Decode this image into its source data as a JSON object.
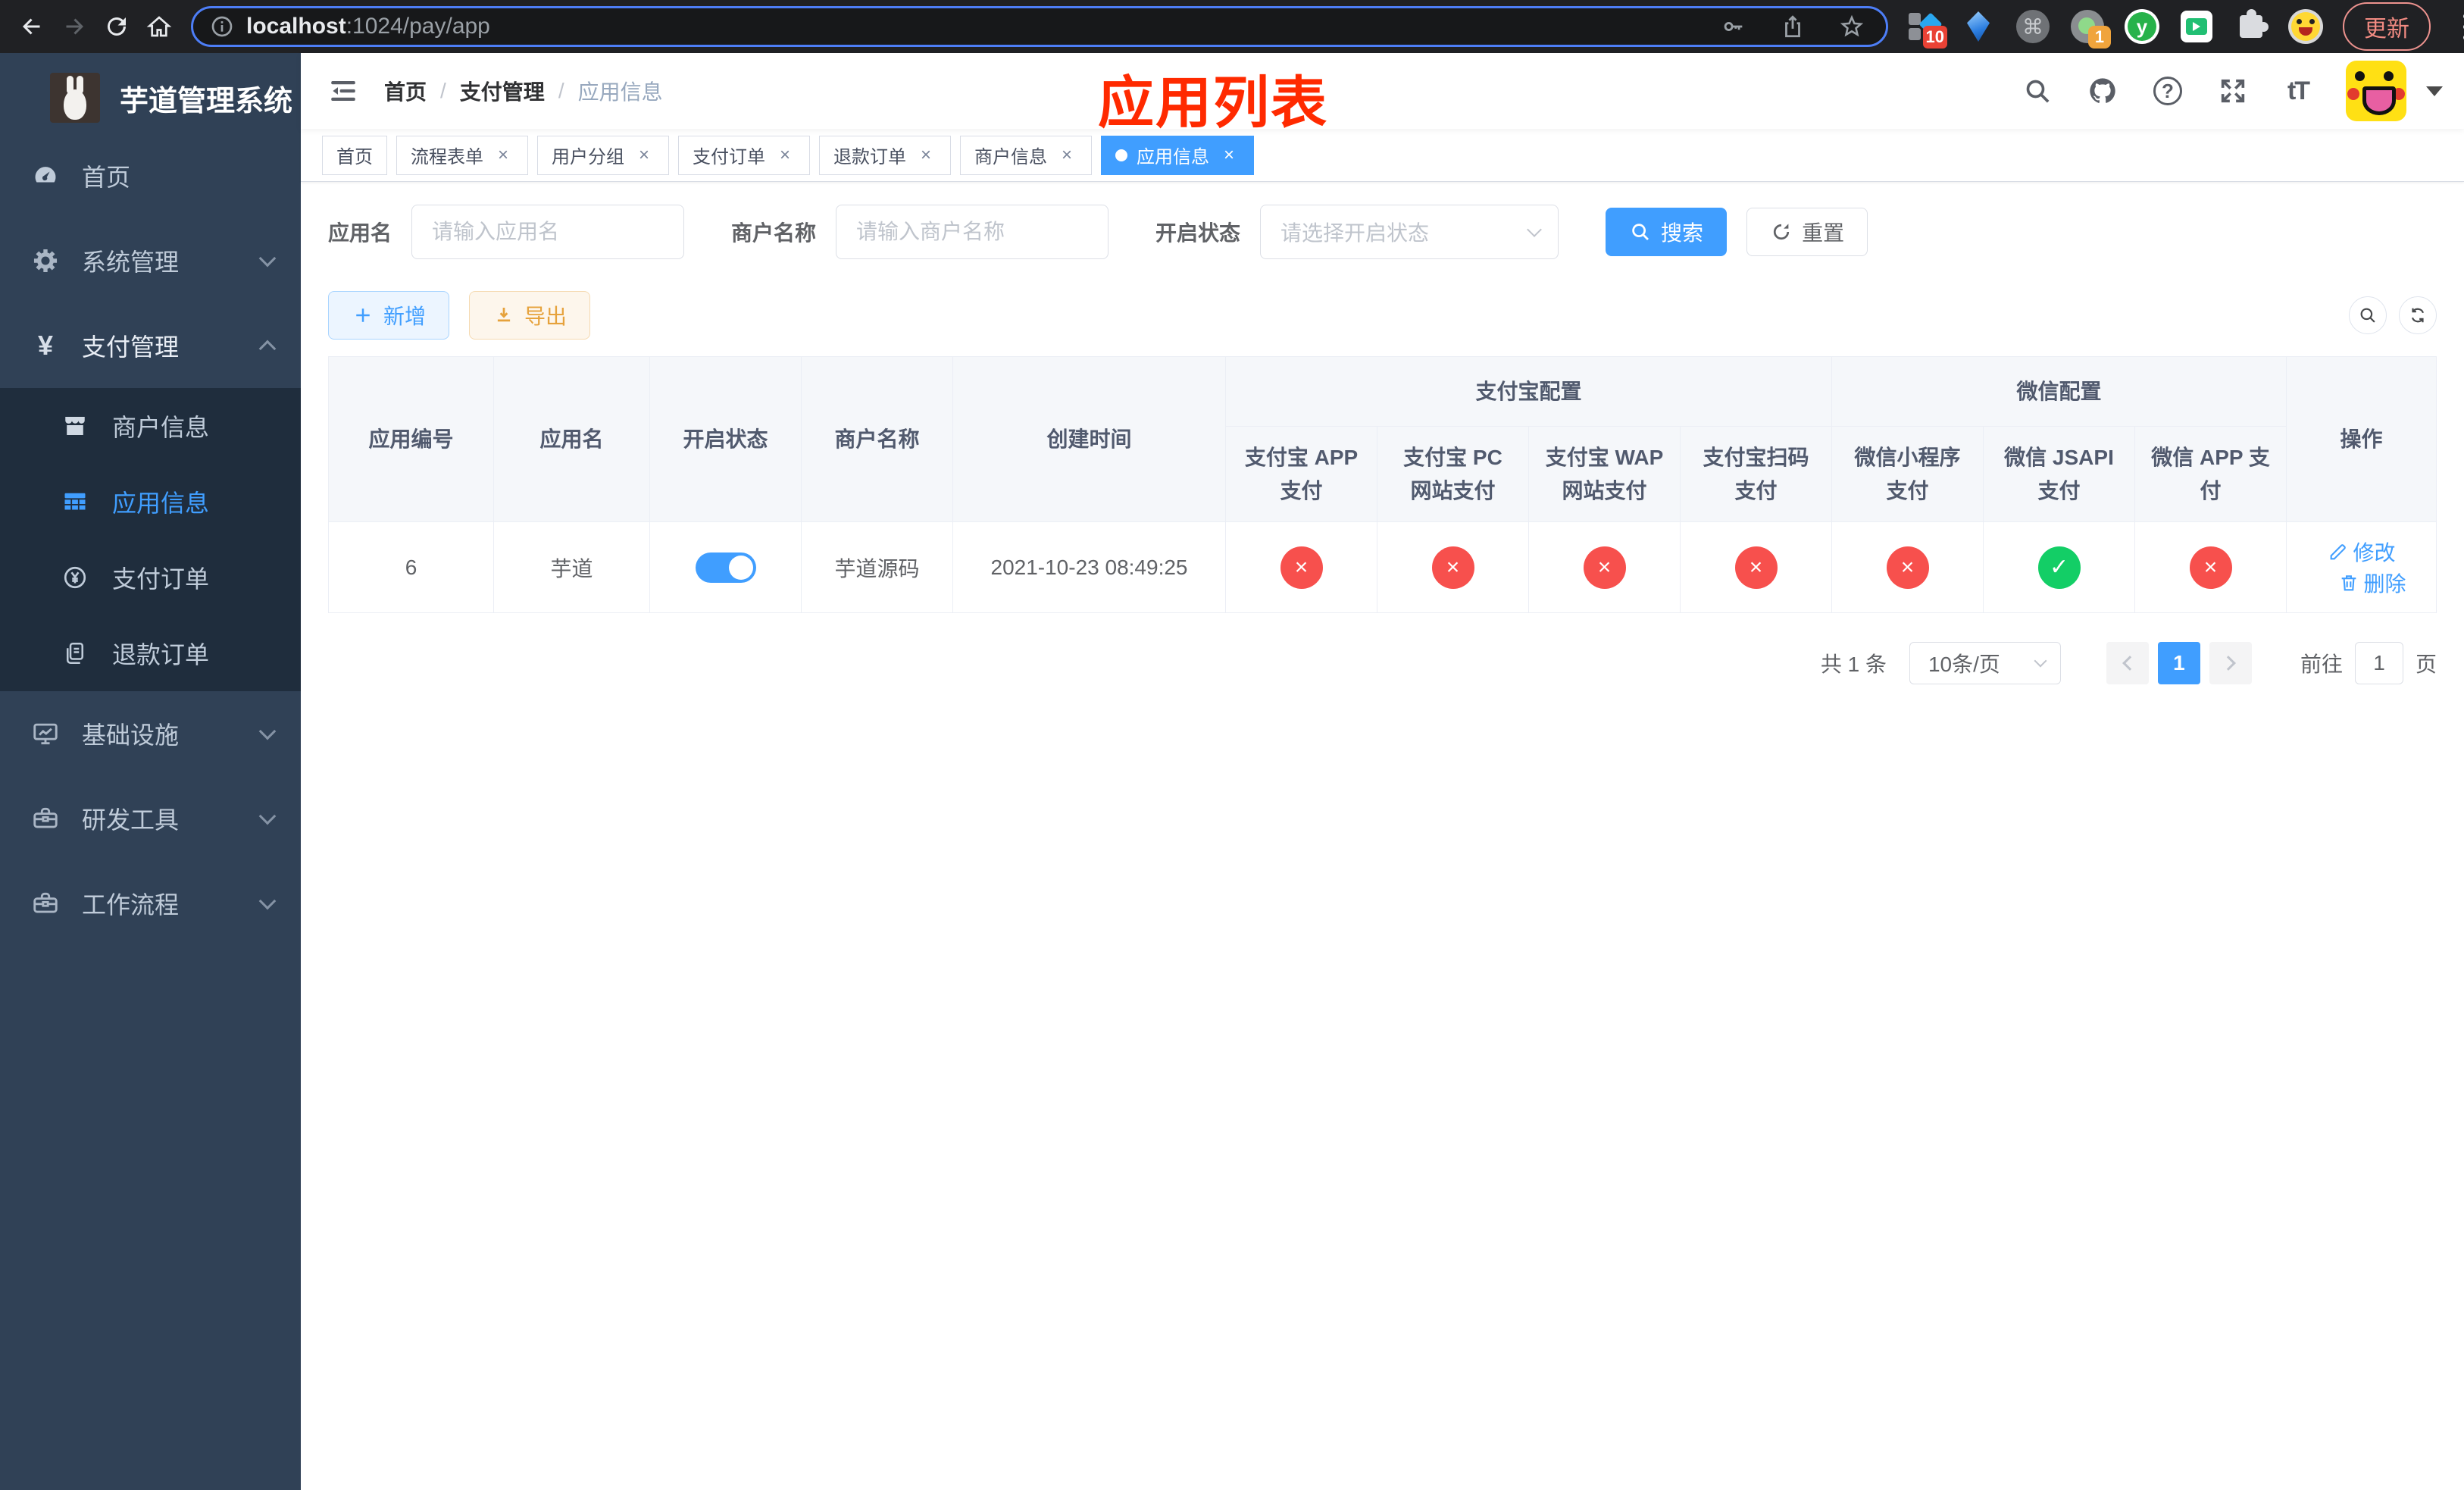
{
  "browser": {
    "url_host": "localhost",
    "url_rest": ":1024/pay/app",
    "update_label": "更新",
    "ext_badge_blocks": "10",
    "ext_badge_dot": "1",
    "ext_y_glyph": "y",
    "ext_cmd_glyph": "⌘"
  },
  "ui": {
    "glyphs": {
      "close": "×",
      "check": "✓",
      "cross": "×",
      "question": "?",
      "fontsize": "tT",
      "yen": "¥"
    }
  },
  "sidebar": {
    "title": "芋道管理系统",
    "items": [
      {
        "label": "首页"
      },
      {
        "label": "系统管理"
      },
      {
        "label": "支付管理"
      },
      {
        "label": "基础设施"
      },
      {
        "label": "研发工具"
      },
      {
        "label": "工作流程"
      }
    ],
    "submenu": [
      {
        "label": "商户信息"
      },
      {
        "label": "应用信息",
        "active": true
      },
      {
        "label": "支付订单"
      },
      {
        "label": "退款订单"
      }
    ]
  },
  "navbar": {
    "breadcrumb": [
      "首页",
      "支付管理",
      "应用信息"
    ],
    "separator": "/",
    "annotation": "应用列表"
  },
  "tags": [
    {
      "label": "首页",
      "closable": false,
      "active": false
    },
    {
      "label": "流程表单",
      "closable": true,
      "active": false
    },
    {
      "label": "用户分组",
      "closable": true,
      "active": false
    },
    {
      "label": "支付订单",
      "closable": true,
      "active": false
    },
    {
      "label": "退款订单",
      "closable": true,
      "active": false
    },
    {
      "label": "商户信息",
      "closable": true,
      "active": false
    },
    {
      "label": "应用信息",
      "closable": true,
      "active": true
    }
  ],
  "search": {
    "app_name_label": "应用名",
    "app_name_placeholder": "请输入应用名",
    "merchant_label": "商户名称",
    "merchant_placeholder": "请输入商户名称",
    "status_label": "开启状态",
    "status_placeholder": "请选择开启状态",
    "search_label": "搜索",
    "reset_label": "重置"
  },
  "toolbar": {
    "add_label": "新增",
    "export_label": "导出"
  },
  "table": {
    "columns": [
      "应用编号",
      "应用名",
      "开启状态",
      "商户名称",
      "创建时间"
    ],
    "groups": [
      {
        "label": "支付宝配置",
        "children": [
          "支付宝 APP 支付",
          "支付宝 PC 网站支付",
          "支付宝 WAP 网站支付",
          "支付宝扫码支付"
        ]
      },
      {
        "label": "微信配置",
        "children": [
          "微信小程序支付",
          "微信 JSAPI 支付",
          "微信 APP 支付"
        ]
      }
    ],
    "op_label": "操作",
    "row": {
      "id": "6",
      "name": "芋道",
      "enabled": true,
      "merchant": "芋道源码",
      "created": "2021-10-23 08:49:25",
      "statuses": [
        "no",
        "no",
        "no",
        "no",
        "no",
        "yes",
        "no"
      ],
      "edit_label": "修改",
      "delete_label": "删除"
    }
  },
  "pagination": {
    "total": "共 1 条",
    "page_size": "10条/页",
    "page": "1",
    "goto_label": "前往",
    "goto_value": "1",
    "unit_label": "页"
  },
  "colors": {
    "primary": "#409eff",
    "danger": "#f7504d",
    "success": "#13ce66",
    "annotation": "#ff2a00"
  }
}
